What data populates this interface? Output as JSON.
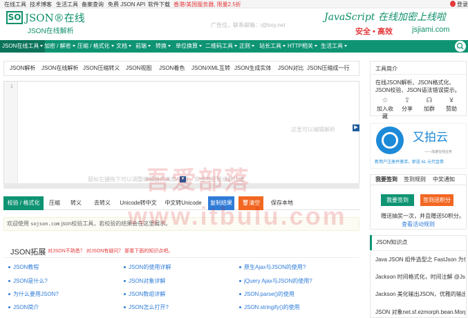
{
  "topbar": {
    "links": [
      "在线工具",
      "技术博客",
      "生活工具",
      "备案查询",
      "免费 JSON API",
      "软件下载"
    ],
    "promo": "香港/美国服务器, 限量2.5折",
    "user_label": "登录"
  },
  "header": {
    "logo_badge": "SO",
    "logo_title": "JSON®在线",
    "logo_sub": "JSON在线解析",
    "ad_text": "广告位，联系邮箱：i@boy.net",
    "promo_title": "JavaScript 在线加密上线啦",
    "promo_tag": "安全 • 高效",
    "promo_site": "jsjiami.com"
  },
  "nav": {
    "items": [
      "JSON在线工具",
      "加密 / 解密",
      "压缩 / 格式化",
      "文档",
      "前端",
      "转换",
      "单位换算",
      "二维码工具",
      "正则",
      "站长工具",
      "HTTP相关",
      "生活工具"
    ]
  },
  "editor_tabs": [
    "JSON解析",
    "JSON在线解析",
    "JSON压缩转义",
    "JSON视图",
    "JSON着色",
    "JSON/XML互转",
    "JSON生成实体",
    "JSON对比",
    "JSON压缩成一行"
  ],
  "editor": {
    "line_number": "1",
    "hint_right": "这里可以编辑解析",
    "hint_bottom": "鼠标左键拖下可以调整编辑器的高度/宽度，双击可还原成默认值"
  },
  "toolbar": {
    "buttons": [
      "校验 / 格式化",
      "压缩",
      "转义",
      "去转义",
      "Unicode转中文",
      "中文转Unicode",
      "复制结果",
      "清空",
      "保存本地"
    ]
  },
  "notice": {
    "prefix": "欢迎使用",
    "site": "sojson.com",
    "suffix": "json校验工具，若校验的结果会在这里展示。"
  },
  "extension": {
    "title": "JSON拓展",
    "subtitle": "对JSON不熟悉？ 对JSON有疑问？ 那看下面的知识点吧。",
    "links": [
      [
        "JSON教程",
        "JSON的使用详解",
        "原生Ajax与JSON的使用?"
      ],
      [
        "JSON是什么?",
        "JSON对象详解",
        "jQuery Ajax与JSON的使用?"
      ],
      [
        "为什么要用JSON?",
        "JSON数组详解",
        "JSON.parse()的使用"
      ],
      [
        "JSON简介",
        "JSON怎么打开?",
        "JSON.stringify()的使用"
      ]
    ]
  },
  "sidebar": {
    "intro_title": "工具简介",
    "intro_text": "在线JSON解析、JSON格式化、JSON校验、JSON语法错误提示。",
    "actions": [
      "加入收藏",
      "分享",
      "加群",
      "赞助"
    ],
    "action_icons": [
      "star-icon",
      "share-icon",
      "group-icon",
      "yen-icon"
    ],
    "ad": {
      "name": "又拍云",
      "slogan": "——加速在线业务",
      "sub": "新用户注册并激活，即送 61 元代金券"
    },
    "sign_tabs": [
      "我要签到",
      "签到规则",
      "中奖通知"
    ],
    "sign_button": "我要签到",
    "lucky_button": "签到送积分",
    "sign_text": "赠送抽奖一次，并且赠送50积分。",
    "sign_rules": "查看活动规则",
    "kb_title": "JSON知识点",
    "kb_items": [
      "Java JSON 组件选型之 FastJson 为什么",
      "Jackson 时间格式化，时间注解 @Json",
      "Jackson 美化输出JSON，优雅的输出JS",
      "JSON 对象net.sf.ezmorph.bean.Morph"
    ]
  },
  "watermark": {
    "line1": "吾爱部落",
    "line2": "www.itbulu.com"
  },
  "colors": {
    "brand": "#0e9473",
    "accent_orange": "#f26722",
    "accent_blue": "#2f7cd8",
    "promo_red": "#e4393c"
  }
}
